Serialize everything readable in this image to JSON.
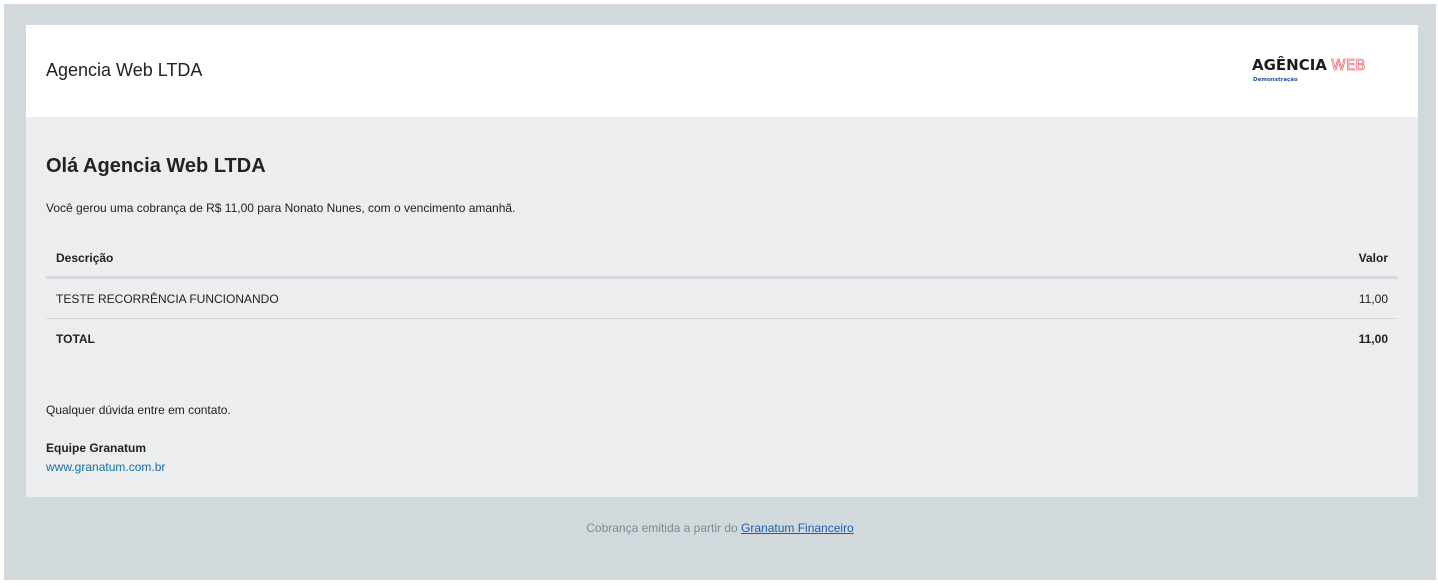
{
  "header": {
    "company_name": "Agencia Web LTDA",
    "logo": {
      "word_primary": "AGÊNCIA",
      "word_secondary": "WEB",
      "tagline": "Demonstração",
      "primary_color": "#1c1c1c",
      "secondary_color": "#e8717a",
      "tagline_color": "#2a4f9c"
    }
  },
  "body": {
    "greeting": "Olá Agencia Web LTDA",
    "intro": "Você gerou uma cobrança de R$ 11,00 para Nonato Nunes, com o vencimento amanhã.",
    "table": {
      "headers": {
        "description": "Descrição",
        "value": "Valor"
      },
      "rows": [
        {
          "description": "TESTE RECORRÊNCIA FUNCIONANDO",
          "value": "11,00"
        }
      ],
      "total": {
        "label": "TOTAL",
        "value": "11,00"
      }
    },
    "closing": "Qualquer dúvida entre em contato.",
    "signature": "Equipe Granatum",
    "website": "www.granatum.com.br"
  },
  "footer": {
    "text": "Cobrança emitida a partir do",
    "link_label": "Granatum Financeiro"
  },
  "colors": {
    "outer_background": "#d2d9dc",
    "card_background": "#ecedef",
    "header_background": "#ffffff",
    "link": "#1a6fa3"
  }
}
